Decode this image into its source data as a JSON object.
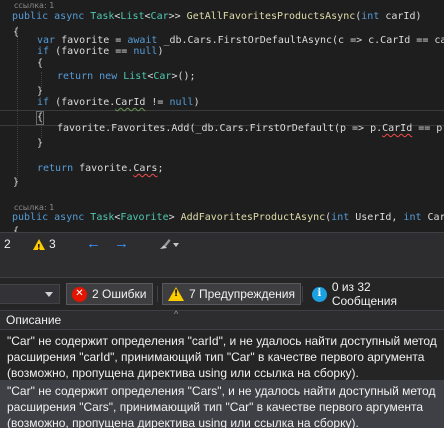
{
  "editor": {
    "ref_label_1": "ссылка: 1",
    "ref_label_2": "ссылка: 1",
    "lines": {
      "l1": [
        "public",
        " ",
        "async",
        " ",
        "Task",
        "<",
        "List",
        "<",
        "Car",
        ">> ",
        "GetAllFavoritesProductsAsync",
        "(",
        "int",
        " carId)"
      ],
      "l3_a": "var",
      "l3_b": " favorite = ",
      "l3_c": "await",
      "l3_d": " _db.Cars.FirstOrDefaultAsync(c => c.CarId == carId);",
      "l4_a": "if",
      "l4_b": " (favorite == ",
      "l4_c": "null",
      "l4_d": ")",
      "l6_a": "return",
      "l6_b": " ",
      "l6_c": "new",
      "l6_d": " ",
      "l6_e": "List",
      "l6_f": "<",
      "l6_g": "Car",
      "l6_h": ">();",
      "l8_a": "if",
      "l8_b": " (favorite.",
      "l8_c": "CarId",
      "l8_d": " != ",
      "l8_e": "null",
      "l8_f": ")",
      "l10_a": "favorite.Favorites.Add(_db.Cars.FirstOrDefault(p => p.",
      "l10_b": "CarId",
      "l10_c": " == p.carId));",
      "l13_a": "return",
      "l13_b": " favorite.",
      "l13_c": "Cars",
      "l13_d": ";",
      "l16": [
        "public",
        " ",
        "async",
        " ",
        "Task",
        "<",
        "Favorite",
        "> ",
        "AddFavoritesProductAsync",
        "(",
        "int",
        " UserId, ",
        "int",
        " CarId)"
      ],
      "open_brace": "{",
      "close_brace": "}"
    }
  },
  "statusbar": {
    "errors_count": "2",
    "warnings_count": "3",
    "back_icon": "arrow-left-icon",
    "forward_icon": "arrow-right-icon",
    "brush_icon": "cleanup-brush-icon"
  },
  "error_list": {
    "filter_errors": "2 Ошибки",
    "filter_warnings": "7 Предупреждения",
    "filter_messages": "0 из 32 Сообщения",
    "column_description": "Описание",
    "sort_indicator": "^",
    "rows": [
      {
        "line1": "\"Car\" не содержит определения \"carId\", и не удалось найти доступный метод",
        "line2": "расширения \"carId\", принимающий тип \"Car\" в качестве первого аргумента",
        "line3": "(возможно, пропущена директива using или ссылка на сборку)."
      },
      {
        "line1": "\"Car\" не содержит определения \"Cars\", и не удалось найти доступный метод",
        "line2": "расширения \"Cars\", принимающий тип \"Car\" в качестве первого аргумента",
        "line3": "(возможно, пропущена директива using или ссылка на сборку)."
      }
    ]
  },
  "colors": {
    "editor_bg": "#1e1e1e",
    "keyword": "#569cd6",
    "type": "#4ec9b0",
    "method": "#dcdcaa",
    "error_red": "#e51400",
    "warning_yellow": "#ffcc00",
    "info_blue": "#1ba1e2"
  }
}
